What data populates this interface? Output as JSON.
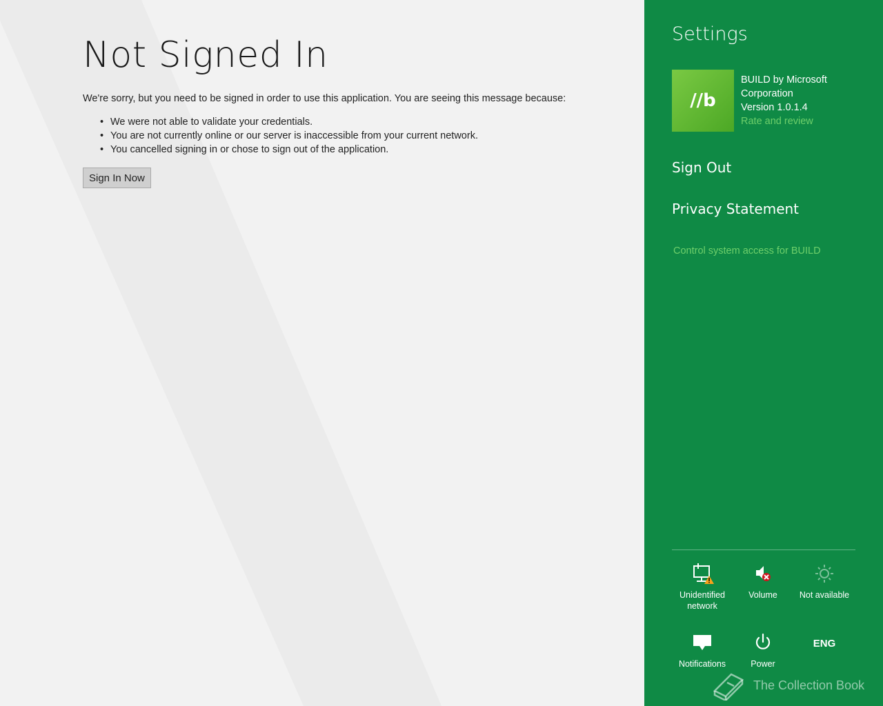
{
  "main": {
    "title": "Not Signed In",
    "intro": "We're sorry, but you need to be signed in order to use this application. You are seeing this message because:",
    "reasons": [
      "We were not able to validate your credentials.",
      "You are not currently online or our server is inaccessible from your current network.",
      "You cancelled signing in or chose to sign out of the application."
    ],
    "bullet": "•",
    "sign_in_button": "Sign In Now"
  },
  "settings": {
    "title": "Settings",
    "app_tile_text": "//b",
    "app_name_line1": "BUILD by Microsoft",
    "app_name_line2": "Corporation",
    "version": "Version 1.0.1.4",
    "rate_link": "Rate and review",
    "sign_out": "Sign Out",
    "privacy": "Privacy Statement",
    "control_access": "Control system access for BUILD",
    "accent_color": "#0f8a45",
    "link_color": "#6fd06b"
  },
  "tray": {
    "network_label_1": "Unidentified",
    "network_label_2": "network",
    "network_icon": "network-warning-icon",
    "volume_label": "Volume",
    "volume_icon": "volume-muted-icon",
    "brightness_label": "Not available",
    "brightness_icon": "brightness-icon",
    "notifications_label": "Notifications",
    "notifications_icon": "notifications-icon",
    "power_label": "Power",
    "power_icon": "power-icon",
    "language_label": "ENG"
  },
  "watermark": {
    "text": "The Collection Book",
    "icon": "book-icon"
  }
}
